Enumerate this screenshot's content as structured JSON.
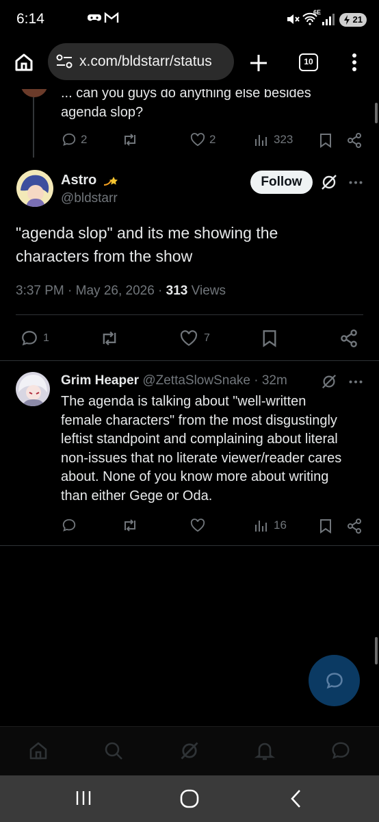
{
  "status_bar": {
    "time": "6:14",
    "network": "6E",
    "battery": "21"
  },
  "browser": {
    "url": "x.com/bldstarr/status",
    "tab_count": "10"
  },
  "parent_tweet": {
    "text_line1": "... can you guys do anything else besides",
    "text_line2": "agenda slop?",
    "replies": "2",
    "likes": "2",
    "views": "323"
  },
  "main_tweet": {
    "display_name": "Astro",
    "handle": "@bldstarr",
    "follow_label": "Follow",
    "text_line1": "\"agenda slop\" and its me showing the",
    "text_line2": "characters from the show",
    "timestamp": "3:37 PM · May 26, 2026 · ",
    "views_count": "313",
    "views_label": " Views",
    "replies": "1",
    "likes": "7"
  },
  "reply_tweet": {
    "display_name": "Grim Heaper",
    "handle": "@ZettaSlowSnake",
    "age": " · 32m",
    "lines": [
      "The agenda is talking about \"well-written",
      "female characters\" from the most disgustingly",
      "leftist standpoint and complaining about literal",
      "non-issues that no literate viewer/reader cares",
      "about. None of you know more about writing",
      "than either Gege or Oda."
    ],
    "views": "16"
  },
  "colors": {
    "background": "#000000",
    "text": "#e7e9ea",
    "muted": "#71767b",
    "divider": "#2f3336",
    "fab": "#0b3a63"
  }
}
